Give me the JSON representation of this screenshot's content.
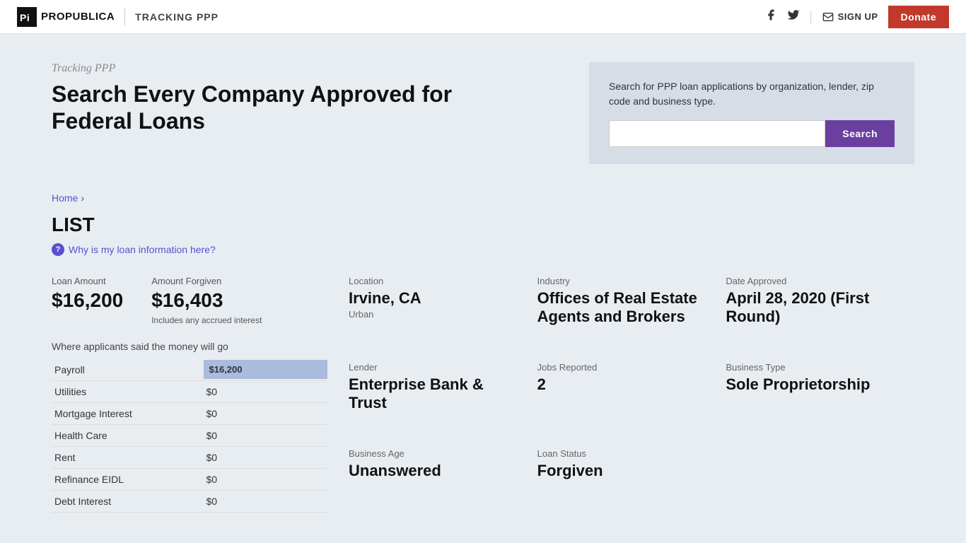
{
  "header": {
    "logo_text": "PROPUBLICA",
    "tracking_label": "TRACKING PPP",
    "social_fb": "f",
    "social_tw": "🐦",
    "signup_label": "SIGN UP",
    "donate_label": "Donate"
  },
  "hero": {
    "subtitle": "Tracking PPP",
    "title_line1": "Search Every Company Approved for",
    "title_line2": "Federal Loans"
  },
  "search": {
    "description": "Search for PPP loan applications by organization, lender, zip code and business type.",
    "placeholder": "",
    "button_label": "Search"
  },
  "breadcrumb": {
    "home": "Home",
    "arrow": "›"
  },
  "list": {
    "heading": "LIST",
    "why_label": "Why is my loan information here?"
  },
  "loan": {
    "amount_label": "Loan Amount",
    "amount_value": "$16,200",
    "forgiven_label": "Amount Forgiven",
    "forgiven_value": "$16,403",
    "forgiven_note": "Includes any accrued interest",
    "allocation_heading": "Where applicants said the money will go",
    "allocations": [
      {
        "label": "Payroll",
        "value": "$16,200",
        "is_payroll": true
      },
      {
        "label": "Utilities",
        "value": "$0"
      },
      {
        "label": "Mortgage Interest",
        "value": "$0"
      },
      {
        "label": "Health Care",
        "value": "$0"
      },
      {
        "label": "Rent",
        "value": "$0"
      },
      {
        "label": "Refinance EIDL",
        "value": "$0"
      },
      {
        "label": "Debt Interest",
        "value": "$0"
      }
    ]
  },
  "info": {
    "location_label": "Location",
    "location_value": "Irvine, CA",
    "location_sub": "Urban",
    "industry_label": "Industry",
    "industry_value": "Offices of Real Estate Agents and Brokers",
    "date_label": "Date Approved",
    "date_value": "April 28, 2020 (First Round)",
    "lender_label": "Lender",
    "lender_value": "Enterprise Bank & Trust",
    "jobs_label": "Jobs Reported",
    "jobs_value": "2",
    "business_type_label": "Business Type",
    "business_type_value": "Sole Proprietorship",
    "business_age_label": "Business Age",
    "business_age_value": "Unanswered",
    "loan_status_label": "Loan Status",
    "loan_status_value": "Forgiven"
  }
}
